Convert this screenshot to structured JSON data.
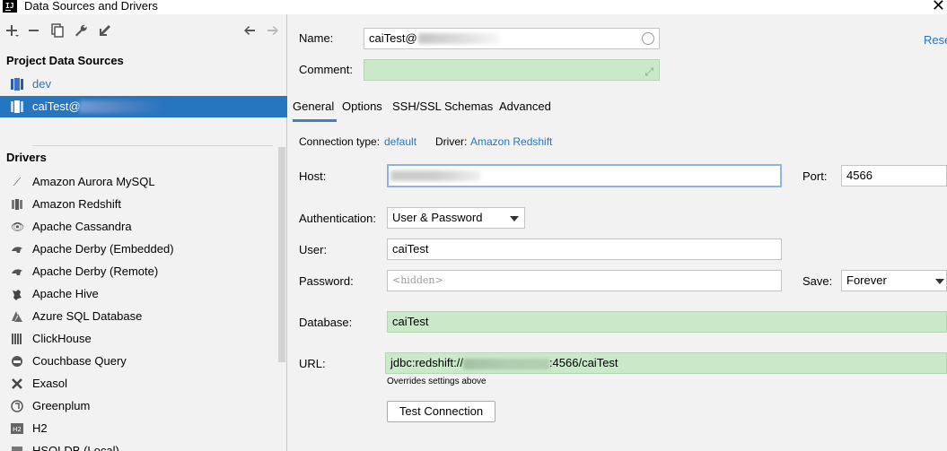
{
  "window": {
    "title": "Data Sources and Drivers",
    "logo": "IJ"
  },
  "left": {
    "project_heading": "Project Data Sources",
    "data_sources": [
      {
        "label": "dev",
        "icon": "redshift-db-icon"
      },
      {
        "label": "caiTest@",
        "icon": "redshift-db-icon",
        "selected": true
      }
    ],
    "drivers_heading": "Drivers",
    "drivers": [
      {
        "label": "Amazon Aurora MySQL",
        "icon": "aurora-icon"
      },
      {
        "label": "Amazon Redshift",
        "icon": "redshift-icon"
      },
      {
        "label": "Apache Cassandra",
        "icon": "cassandra-icon"
      },
      {
        "label": "Apache Derby (Embedded)",
        "icon": "derby-icon"
      },
      {
        "label": "Apache Derby (Remote)",
        "icon": "derby-icon"
      },
      {
        "label": "Apache Hive",
        "icon": "hive-icon"
      },
      {
        "label": "Azure SQL Database",
        "icon": "azure-icon"
      },
      {
        "label": "ClickHouse",
        "icon": "clickhouse-icon"
      },
      {
        "label": "Couchbase Query",
        "icon": "couchbase-icon"
      },
      {
        "label": "Exasol",
        "icon": "exasol-icon"
      },
      {
        "label": "Greenplum",
        "icon": "greenplum-icon"
      },
      {
        "label": "H2",
        "icon": "h2-icon"
      },
      {
        "label": "HSQLDB (Local)",
        "icon": "hsqldb-icon"
      }
    ]
  },
  "form": {
    "name_label": "Name:",
    "name_value": "caiTest@",
    "reset_label": "Rese",
    "comment_label": "Comment:",
    "comment_value": "",
    "tabs": [
      "General",
      "Options",
      "SSH/SSL",
      "Schemas",
      "Advanced"
    ],
    "connection_type_label": "Connection type:",
    "connection_type_value": "default",
    "driver_label": "Driver:",
    "driver_value": "Amazon Redshift",
    "host_label": "Host:",
    "host_value": "",
    "port_label": "Port:",
    "port_value": "4566",
    "auth_label": "Authentication:",
    "auth_value": "User & Password",
    "user_label": "User:",
    "user_value": "caiTest",
    "password_label": "Password:",
    "password_placeholder": "<hidden>",
    "save_label": "Save:",
    "save_value": "Forever",
    "database_label": "Database:",
    "database_value": "caiTest",
    "url_label": "URL:",
    "url_prefix": "jdbc:redshift://",
    "url_suffix": ":4566/caiTest",
    "url_hint": "Overrides settings above",
    "test_button": "Test Connection"
  },
  "colors": {
    "accent": "#2675bf",
    "green_field": "#c9e9c9",
    "selection": "#2675bf"
  }
}
